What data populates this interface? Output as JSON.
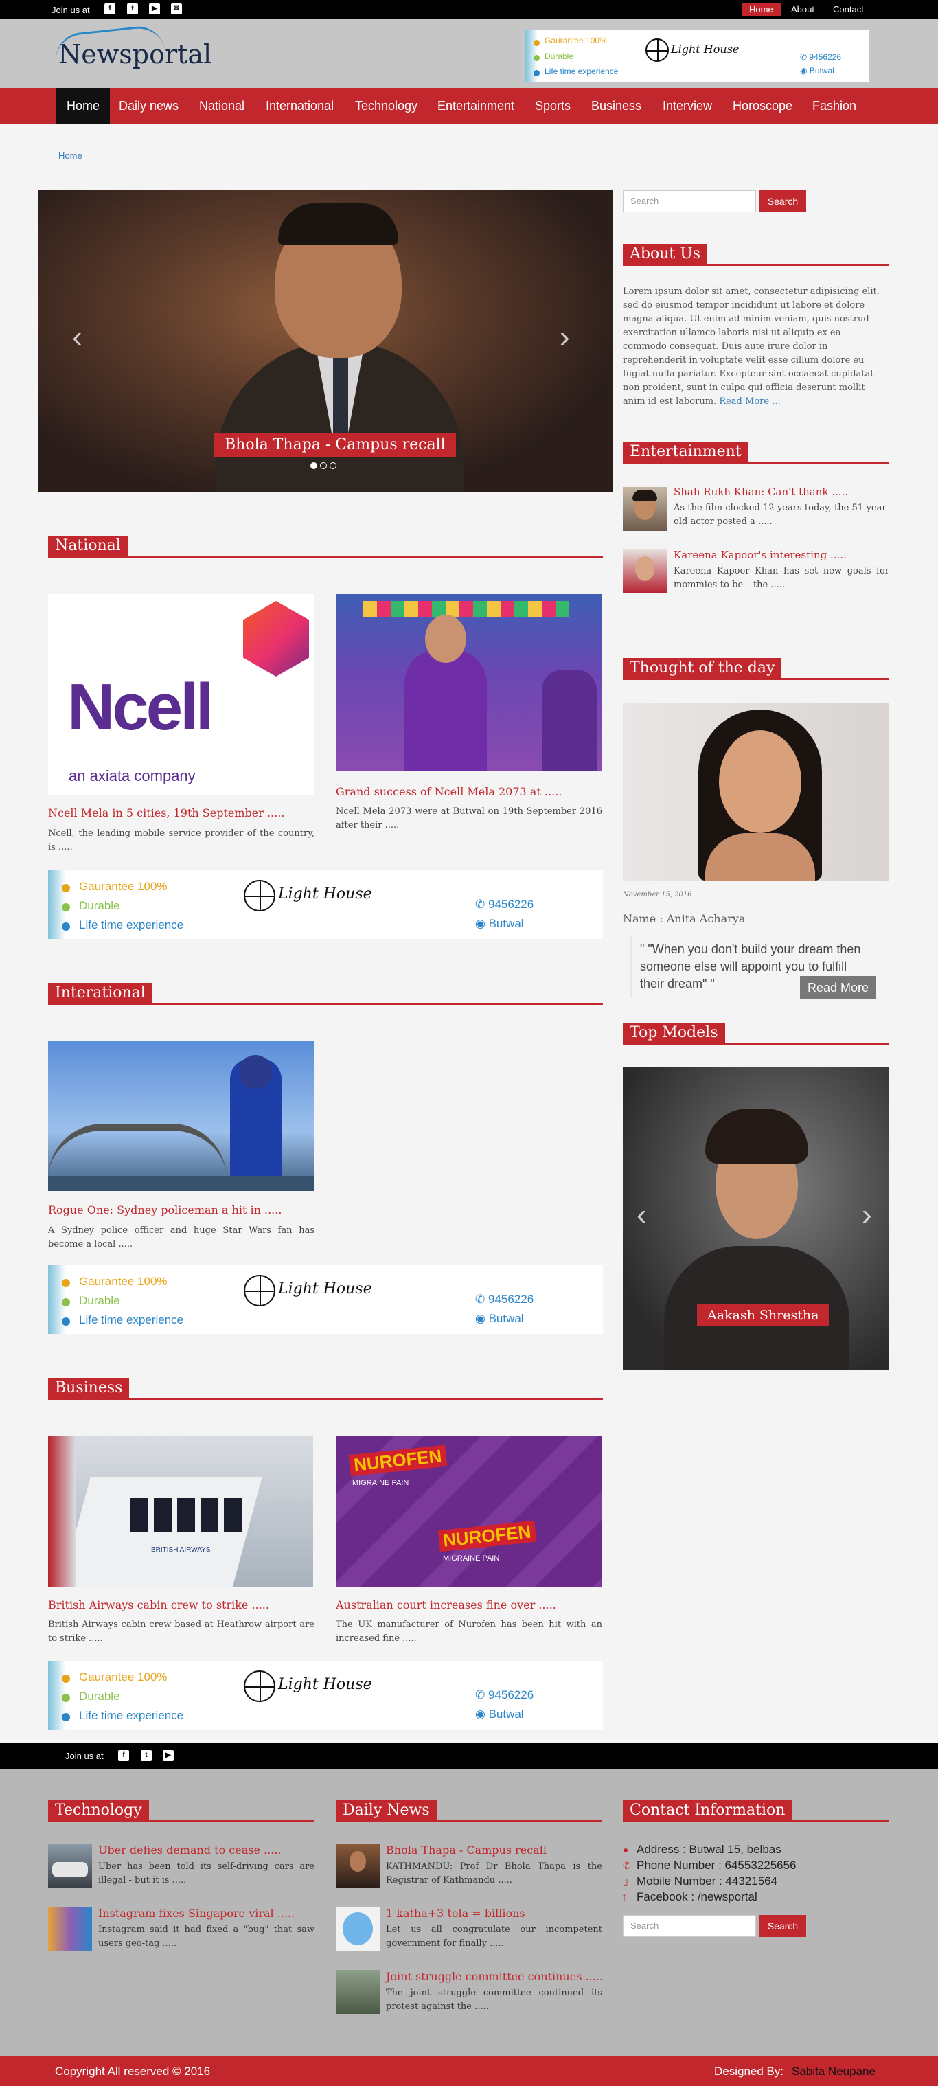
{
  "topbar": {
    "join_label": "Join us at",
    "nav": [
      "Home",
      "About",
      "Contact"
    ]
  },
  "brand": {
    "logo_text": "Newsportal"
  },
  "ad": {
    "lines": [
      "Gaurantee 100%",
      "Durable",
      "Life time experience"
    ],
    "brand": "Light House",
    "phone": "9456226",
    "location": "Butwal"
  },
  "nav": {
    "items": [
      "Home",
      "Daily news",
      "National",
      "International",
      "Technology",
      "Entertainment",
      "Sports",
      "Business",
      "Interview",
      "Horoscope",
      "Fashion"
    ],
    "active": "Home"
  },
  "breadcrumb": "Home",
  "slider": {
    "caption": "Bhola Thapa - Campus recall",
    "prev": "‹",
    "next": "›",
    "slides": 3,
    "active_slide": 1
  },
  "sections": {
    "national": {
      "title": "National",
      "items": [
        {
          "title": "Ncell Mela in 5 cities, 19th September .....",
          "text": "Ncell, the leading mobile service provider of the country, is .....",
          "image_text": "Ncell",
          "image_sub": "an axiata company"
        },
        {
          "title": "Grand success of Ncell Mela 2073 at .....",
          "text": "Ncell Mela 2073 were at Butwal on 19th September 2016 after their ....."
        }
      ]
    },
    "international": {
      "title": "Interational",
      "items": [
        {
          "title": "Rogue One: Sydney policeman a hit in .....",
          "text": "A Sydney police officer and huge Star Wars fan has become a local ....."
        }
      ]
    },
    "business": {
      "title": "Business",
      "items": [
        {
          "title": "British Airways cabin crew to strike .....",
          "text": "British Airways cabin crew based at Heathrow airport are to strike .....",
          "image_text": "BRITISH AIRWAYS"
        },
        {
          "title": "Australian court increases fine over .....",
          "text": "The UK manufacturer of Nurofen has been hit with an increased fine .....",
          "image_text": "NUROFEN",
          "image_sub": "MIGRAINE PAIN"
        }
      ]
    }
  },
  "sidebar": {
    "search_placeholder": "Search",
    "search_button": "Search",
    "about": {
      "title": "About Us",
      "text": "Lorem ipsum dolor sit amet, consectetur adipisicing elit, sed do eiusmod tempor incididunt ut labore et dolore magna aliqua. Ut enim ad minim veniam, quis nostrud exercitation ullamco laboris nisi ut aliquip ex ea commodo consequat. Duis aute irure dolor in reprehenderit in voluptate velit esse cillum dolore eu fugiat nulla pariatur. Excepteur sint occaecat cupidatat non proident, sunt in culpa qui officia deserunt mollit anim id est laborum.",
      "link": "Read More ..."
    },
    "entertainment": {
      "title": "Entertainment",
      "items": [
        {
          "title": "Shah Rukh Khan: Can't thank .....",
          "text": "As the film clocked 12 years today, the 51-year-old actor posted a ....."
        },
        {
          "title": "Kareena Kapoor's interesting .....",
          "text": "Kareena Kapoor Khan has set new goals for mommies-to-be – the ....."
        }
      ]
    },
    "thought": {
      "title": "Thought of the day",
      "date": "November 15, 2016",
      "name": "Name : Anita Acharya",
      "quote": "\" \"When you don't build your dream then someone else will appoint you to fulfill their dream\" \"",
      "button": "Read More"
    },
    "models": {
      "title": "Top Models",
      "caption": "Aakash Shrestha",
      "prev": "‹",
      "next": "›"
    }
  },
  "footer": {
    "join_label": "Join us at",
    "technology": {
      "title": "Technology",
      "items": [
        {
          "title": "Uber defies demand to cease .....",
          "text": "Uber has been told its self-driving cars are illegal - but it is ....."
        },
        {
          "title": "Instagram fixes Singapore viral .....",
          "text": "Instagram said it had fixed a \"bug\" that saw users geo-tag ....."
        }
      ]
    },
    "daily": {
      "title": "Daily News",
      "items": [
        {
          "title": "Bhola Thapa - Campus recall",
          "text": "KATHMANDU: Prof Dr Bhola Thapa is the Registrar of Kathmandu ....."
        },
        {
          "title": "1 katha+3 tola = billions",
          "text": "Let us all congratulate our incompetent government for finally ....."
        },
        {
          "title": "Joint struggle committee continues .....",
          "text": "The joint struggle committee continued its protest against the ....."
        }
      ]
    },
    "contact": {
      "title": "Contact Information",
      "address": "Address : Butwal 15, belbas",
      "phone": "Phone Number : 64553225656",
      "mobile": "Mobile Number : 44321564",
      "facebook": "Facebook : /newsportal",
      "search_placeholder": "Search",
      "search_button": "Search"
    },
    "copyright": "Copyright All reserved © 2016",
    "designed_by_label": "Designed By:",
    "designer": "Sabita Neupane"
  },
  "colors": {
    "accent": "#c1272d",
    "topbar": "#000000",
    "header": "#c6c6c6",
    "footer": "#b7b7b7"
  }
}
